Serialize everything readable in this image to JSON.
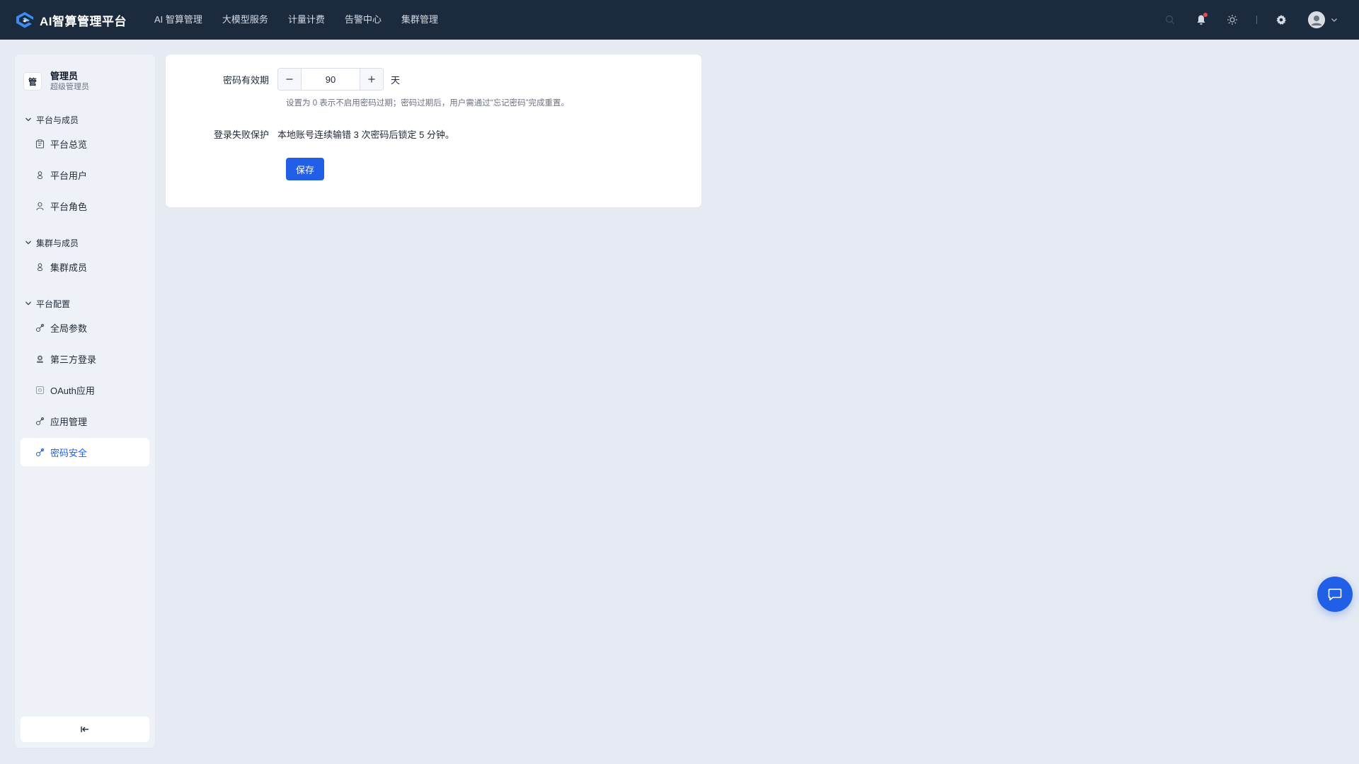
{
  "app": {
    "title": "AI智算管理平台"
  },
  "top_nav": {
    "items": [
      {
        "label": "AI 智算管理"
      },
      {
        "label": "大模型服务"
      },
      {
        "label": "计量计费"
      },
      {
        "label": "告警中心"
      },
      {
        "label": "集群管理"
      }
    ]
  },
  "top_actions": {
    "icons": [
      "search-icon",
      "bell-icon",
      "sun-icon",
      "gear-icon",
      "avatar"
    ],
    "has_notification": true
  },
  "sidebar": {
    "profile": {
      "badge": "管",
      "name": "管理员",
      "role": "超级管理员"
    },
    "sections": [
      {
        "title": "平台与成员",
        "items": [
          {
            "label": "平台总览",
            "icon": "clipboard-icon"
          },
          {
            "label": "平台用户",
            "icon": "users-icon"
          },
          {
            "label": "平台角色",
            "icon": "user-icon"
          }
        ]
      },
      {
        "title": "集群与成员",
        "items": [
          {
            "label": "集群成员",
            "icon": "users-icon"
          }
        ]
      },
      {
        "title": "平台配置",
        "items": [
          {
            "label": "全局参数",
            "icon": "key-icon"
          },
          {
            "label": "第三方登录",
            "icon": "badge-icon"
          },
          {
            "label": "OAuth应用",
            "icon": "app-icon"
          },
          {
            "label": "应用管理",
            "icon": "key-icon"
          },
          {
            "label": "密码安全",
            "icon": "key-icon",
            "active": true
          }
        ]
      }
    ],
    "collapse_icon": "collapse-left-icon"
  },
  "form": {
    "expiry": {
      "label": "密码有效期",
      "value": "90",
      "unit": "天",
      "hint": "设置为 0 表示不启用密码过期；密码过期后，用户需通过“忘记密码”完成重置。"
    },
    "protection": {
      "label": "登录失败保护",
      "text": "本地账号连续输错 3 次密码后锁定 5 分钟。"
    },
    "save_label": "保存"
  },
  "colors": {
    "topbar": "#1c2a3d",
    "accent": "#2160e6",
    "background": "#e6ebf3",
    "notification": "#f04848"
  }
}
